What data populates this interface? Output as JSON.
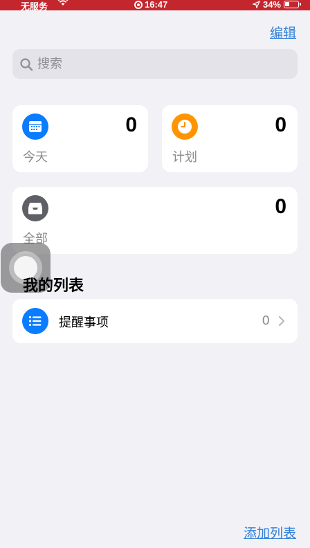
{
  "status_bar": {
    "carrier": "无服务",
    "time": "16:47",
    "battery": "34%"
  },
  "header": {
    "edit_label": "编辑"
  },
  "search": {
    "placeholder": "搜索"
  },
  "smart_lists": [
    {
      "label": "今天",
      "count": "0",
      "icon": "calendar-icon",
      "color": "#0a7cff"
    },
    {
      "label": "计划",
      "count": "0",
      "icon": "clock-icon",
      "color": "#ff9505"
    },
    {
      "label": "全部",
      "count": "0",
      "icon": "tray-icon",
      "color": "#5e6066"
    }
  ],
  "my_lists": {
    "title": "我的列表",
    "items": [
      {
        "name": "提醒事项",
        "count": "0",
        "icon": "list-icon",
        "color": "#0a7cff"
      }
    ]
  },
  "footer": {
    "add_list_label": "添加列表"
  },
  "colors": {
    "accent": "#2f80d8",
    "status_bar": "#c4262e",
    "background": "#f2f1f6"
  }
}
